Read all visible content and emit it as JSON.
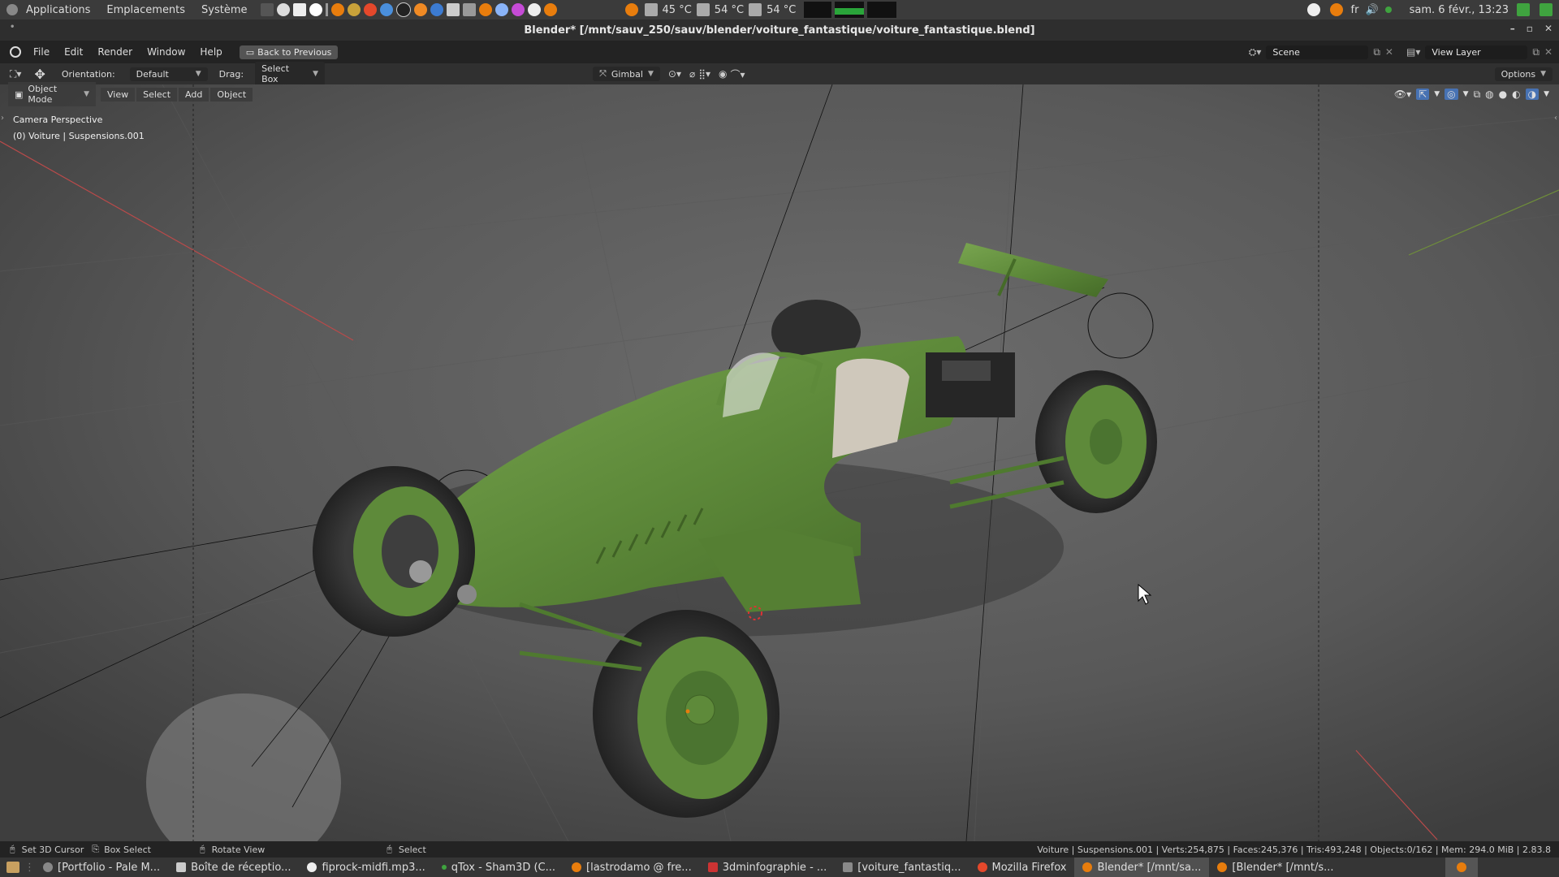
{
  "system_bar": {
    "menus": [
      "Applications",
      "Emplacements",
      "Système"
    ],
    "temps": [
      "45 °C",
      "54 °C",
      "54 °C"
    ],
    "lang": "fr",
    "datetime": "sam. 6 févr., 13:23"
  },
  "window": {
    "title": "Blender* [/mnt/sauv_250/sauv/blender/voiture_fantastique/voiture_fantastique.blend]",
    "controls": [
      "–",
      "▫",
      "✕"
    ]
  },
  "menubar": {
    "items": [
      "File",
      "Edit",
      "Render",
      "Window",
      "Help"
    ],
    "back_button": "Back to Previous",
    "scene": "Scene",
    "view_layer": "View Layer"
  },
  "toolheader": {
    "orientation_label": "Orientation:",
    "orientation_value": "Default",
    "drag_label": "Drag:",
    "drag_value": "Select Box",
    "transform_orientation": "Gimbal",
    "options": "Options"
  },
  "viewport_header": {
    "mode": "Object Mode",
    "menus": [
      "View",
      "Select",
      "Add",
      "Object"
    ]
  },
  "viewport": {
    "camera_label": "Camera Perspective",
    "object_label": "(0) Voiture | Suspensions.001"
  },
  "statusbar": {
    "hints": [
      "Set 3D Cursor",
      "Box Select",
      "Rotate View",
      "Select"
    ],
    "stats": "Voiture | Suspensions.001 | Verts:254,875 | Faces:245,376 | Tris:493,248 | Objects:0/162 | Mem: 294.0 MiB | 2.83.8"
  },
  "taskbar": {
    "tasks": [
      "[Portfolio - Pale M...",
      "Boîte de réceptio...",
      "fiprock-midfi.mp3...",
      "qTox - Sham3D (C...",
      "[lastrodamo @ fre...",
      "3dminfographie - ...",
      "[voiture_fantastiq...",
      "Mozilla Firefox",
      "Blender* [/mnt/sa...",
      "[Blender* [/mnt/s..."
    ]
  },
  "colors": {
    "car_green": "#5e8a3a",
    "tire": "#2a2a2a",
    "blender_orange": "#e87d0d"
  }
}
